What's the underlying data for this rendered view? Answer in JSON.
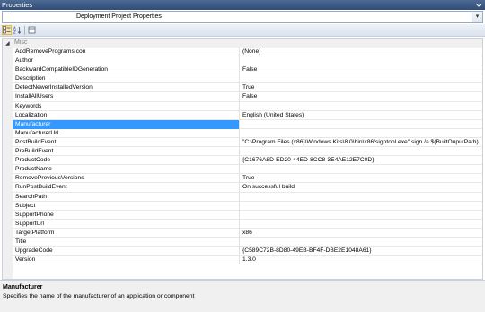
{
  "window": {
    "title": "Properties"
  },
  "object_selector": {
    "value": "Deployment Project Properties"
  },
  "category": {
    "label": "Misc",
    "expanded_glyph": "◢"
  },
  "properties": [
    {
      "name": "AddRemoveProgramsIcon",
      "value": "(None)"
    },
    {
      "name": "Author",
      "value": ""
    },
    {
      "name": "BackwardCompatibleIDGeneration",
      "value": "False"
    },
    {
      "name": "Description",
      "value": ""
    },
    {
      "name": "DetectNewerInstalledVersion",
      "value": "True"
    },
    {
      "name": "InstallAllUsers",
      "value": "False"
    },
    {
      "name": "Keywords",
      "value": ""
    },
    {
      "name": "Localization",
      "value": "English (United States)"
    },
    {
      "name": "Manufacturer",
      "value": ""
    },
    {
      "name": "ManufacturerUrl",
      "value": ""
    },
    {
      "name": "PostBuildEvent",
      "value": "\"C:\\Program Files (x86)\\Windows Kits\\8.0\\bin\\x86\\signtool.exe\" sign /a  $(BuiltOuputPath)"
    },
    {
      "name": "PreBuildEvent",
      "value": ""
    },
    {
      "name": "ProductCode",
      "value": "{C1676A8D-ED20-44ED-8CC8-3E4AE12E7C0D}"
    },
    {
      "name": "ProductName",
      "value": ""
    },
    {
      "name": "RemovePreviousVersions",
      "value": "True"
    },
    {
      "name": "RunPostBuildEvent",
      "value": "On successful build"
    },
    {
      "name": "SearchPath",
      "value": ""
    },
    {
      "name": "Subject",
      "value": ""
    },
    {
      "name": "SupportPhone",
      "value": ""
    },
    {
      "name": "SupportUrl",
      "value": ""
    },
    {
      "name": "TargetPlatform",
      "value": "x86"
    },
    {
      "name": "Title",
      "value": ""
    },
    {
      "name": "UpgradeCode",
      "value": "{C589C72B-8D80-49EB-BF4F-DBE2E1048A61}"
    },
    {
      "name": "Version",
      "value": "1.3.0"
    }
  ],
  "selected_property": "Manufacturer",
  "description": {
    "title": "Manufacturer",
    "text": "Specifies the name of the manufacturer of an application or component"
  },
  "toolbar": {
    "buttons": [
      {
        "icon": "categorized-icon",
        "active": true
      },
      {
        "icon": "alphabetical-icon",
        "active": false
      },
      {
        "icon": "property-pages-icon",
        "active": false
      }
    ]
  },
  "colors": {
    "selection": "#3399ff",
    "title_bar": "#3b5a86"
  }
}
